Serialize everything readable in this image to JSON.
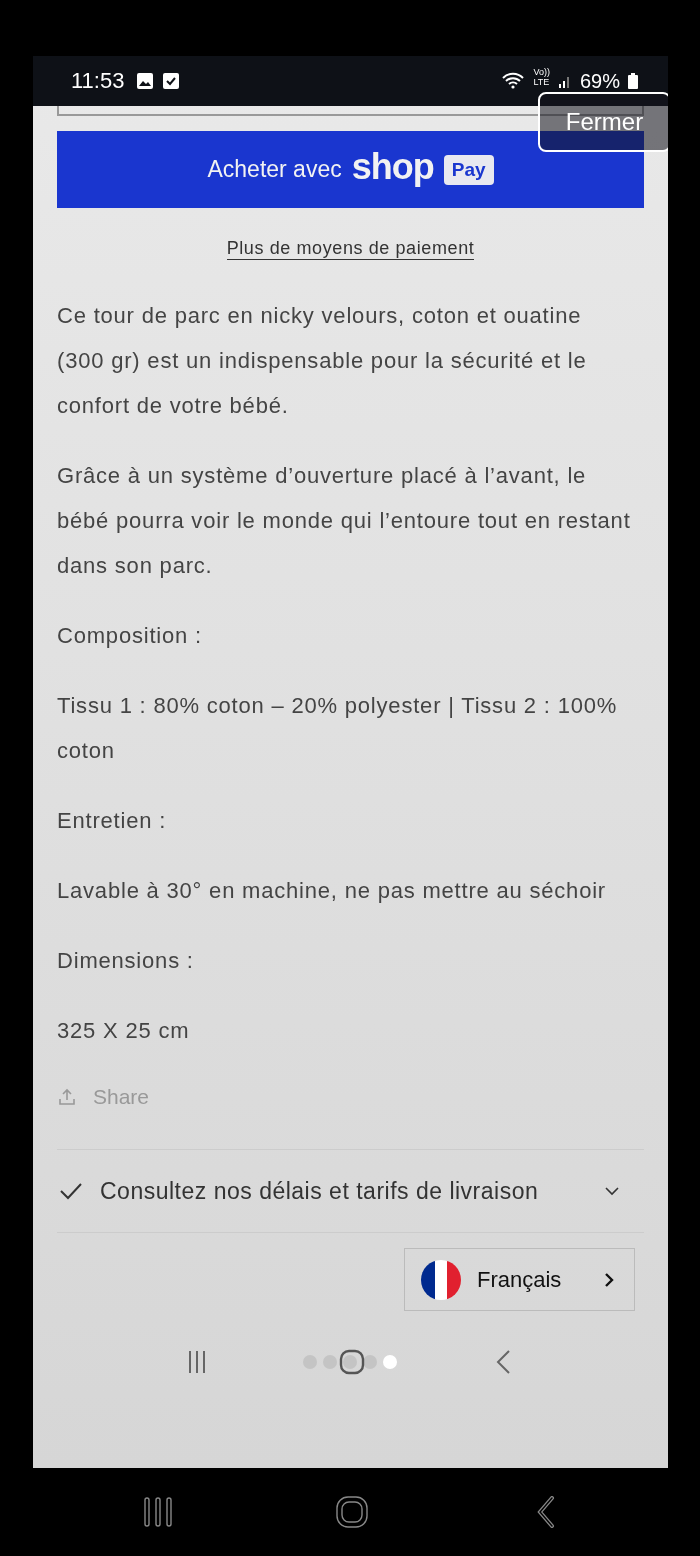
{
  "status_bar": {
    "time": "11:53",
    "network": [
      "Vo))",
      "LTE"
    ],
    "battery": "69%"
  },
  "close_overlay": {
    "label": "Fermer"
  },
  "shop_pay_button": {
    "label": "Acheter avec",
    "brand": "shop",
    "badge": "Pay"
  },
  "more_payment_link": "Plus de moyens de paiement",
  "description": [
    "Ce tour de parc en nicky velours, coton et ouatine (300 gr) est un indispensable pour la sécurité et le confort de votre bébé.",
    "Grâce à un système d’ouverture placé à l’avant, le bébé pourra voir le monde qui l’entoure tout en restant dans son parc.",
    "Composition :",
    "Tissu 1 : 80% coton – 20% polyester | Tissu 2 : 100% coton",
    "Entretien :",
    "Lavable à 30° en machine, ne pas mettre au séchoir",
    "Dimensions :",
    "325 X 25 cm"
  ],
  "share": "Share",
  "shipping_accordion": {
    "label": "Consultez nos délais et tarifs de livraison",
    "expanded": false
  },
  "language_selector": {
    "label": "Français"
  },
  "page_dots": [
    {
      "selected": false
    },
    {
      "selected": false
    },
    {
      "selected": false
    },
    {
      "selected": false
    },
    {
      "selected": true
    }
  ]
}
